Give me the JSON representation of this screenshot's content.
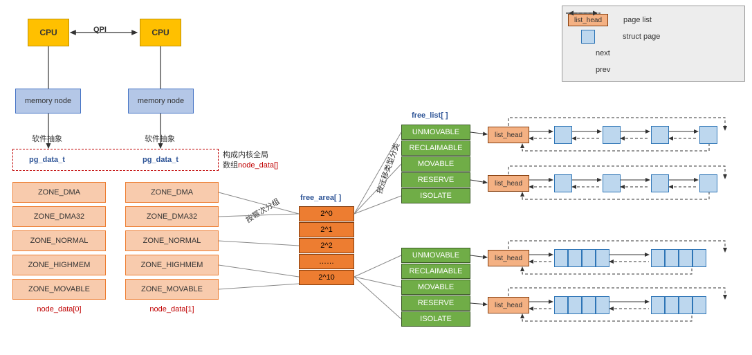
{
  "cpu": "CPU",
  "qpi": "QPI",
  "mem": "memory node",
  "abstract": "软件抽象",
  "pgdata": "pg_data_t",
  "globalNote1": "构成内核全局",
  "globalNote2": "数组",
  "globalNote2b": "node_data[]",
  "zones": [
    "ZONE_DMA",
    "ZONE_DMA32",
    "ZONE_NORMAL",
    "ZONE_HIGHMEM",
    "ZONE_MOVABLE"
  ],
  "nodeCap0": "node_data[0]",
  "nodeCap1": "node_data[1]",
  "faHead": "free_area[ ]",
  "faItems": [
    "2^0",
    "2^1",
    "2^2",
    "……",
    "2^10"
  ],
  "groupNote": "按幂次分组",
  "flHead": "free_list[ ]",
  "flItems": [
    "UNMOVABLE",
    "RECLAIMABLE",
    "MOVABLE",
    "RESERVE",
    "ISOLATE"
  ],
  "typeNote": "按迁移类型分类",
  "listHead": "list_head",
  "legend": {
    "lh": "list_head",
    "pl": "page list",
    "sp": "struct page",
    "next": "next",
    "prev": "prev"
  }
}
